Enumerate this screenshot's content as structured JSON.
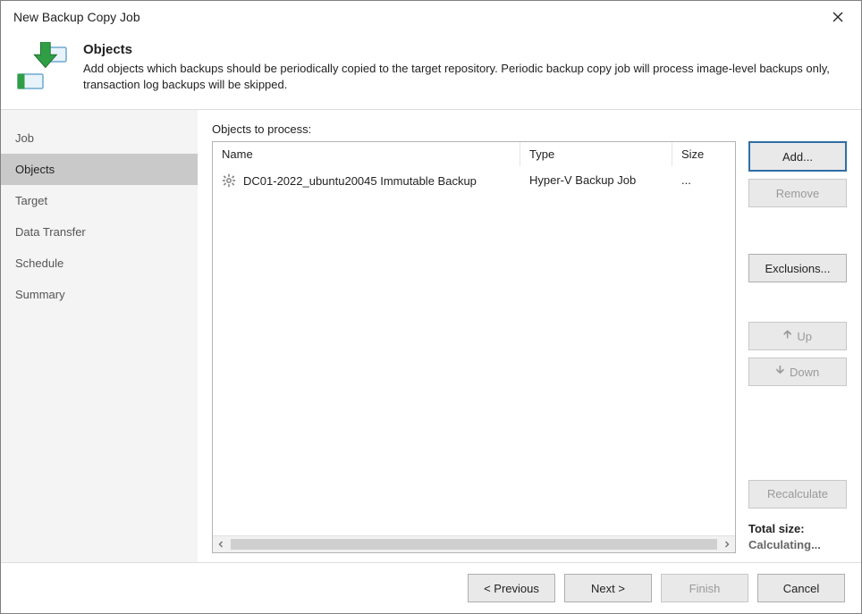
{
  "window": {
    "title": "New Backup Copy Job"
  },
  "banner": {
    "heading": "Objects",
    "description": "Add objects which backups should be periodically copied to the target repository. Periodic backup copy job will process image-level backups only, transaction log backups will be skipped."
  },
  "steps": [
    "Job",
    "Objects",
    "Target",
    "Data Transfer",
    "Schedule",
    "Summary"
  ],
  "active_step_index": 1,
  "main": {
    "list_label": "Objects to process:",
    "columns": {
      "name": "Name",
      "type": "Type",
      "size": "Size"
    },
    "rows": [
      {
        "name": "DC01-2022_ubuntu20045 Immutable Backup",
        "type": "Hyper-V Backup Job",
        "size": "..."
      }
    ]
  },
  "buttons": {
    "add": "Add...",
    "remove": "Remove",
    "exclusions": "Exclusions...",
    "up": "Up",
    "down": "Down",
    "recalculate": "Recalculate",
    "previous": "< Previous",
    "next": "Next >",
    "finish": "Finish",
    "cancel": "Cancel"
  },
  "total": {
    "label": "Total size:",
    "value": "Calculating..."
  }
}
